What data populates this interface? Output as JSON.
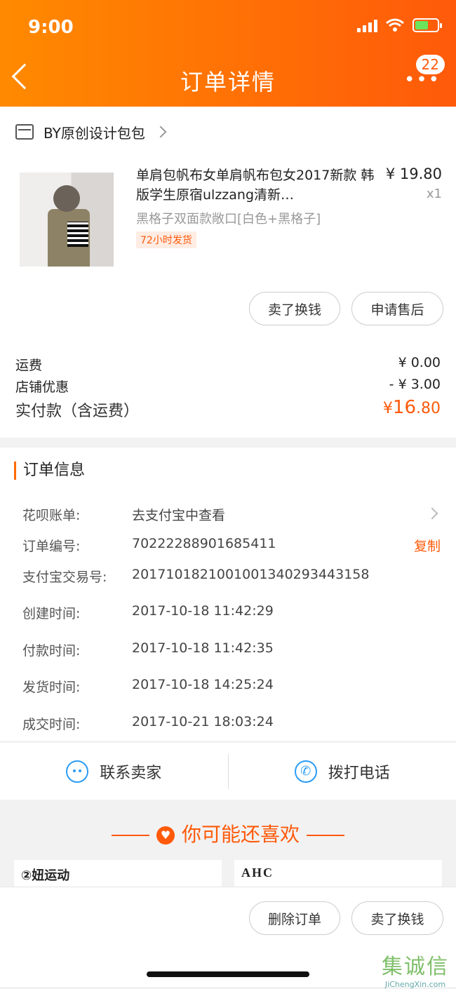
{
  "status": {
    "time": "9:00"
  },
  "header": {
    "title": "订单详情",
    "badge": "22",
    "more": "•••"
  },
  "store": {
    "name": "BY原创设计包包"
  },
  "product": {
    "title": "单肩包帆布女单肩帆布包女2017新款 韩版学生原宿ulzzang清新…",
    "price": "¥ 19.80",
    "qty": "x1",
    "sku": "黑格子双面款敞口[白色+黑格子]",
    "tag": "72小时发货"
  },
  "actions": {
    "sell": "卖了换钱",
    "after_sale": "申请售后"
  },
  "fees": {
    "shipping_label": "运费",
    "shipping_value": "¥ 0.00",
    "discount_label": "店铺优惠",
    "discount_value": "- ¥ 3.00",
    "paid_label": "实付款（含运费）",
    "paid_currency": "¥",
    "paid_int": "16",
    "paid_dec": ".80"
  },
  "order_info": {
    "title": "订单信息",
    "huabei_label": "花呗账单:",
    "huabei_value": "去支付宝中查看",
    "order_no_label": "订单编号:",
    "order_no": "70222288901685411",
    "copy": "复制",
    "alipay_label": "支付宝交易号:",
    "alipay_no": "2017101821001001340293443158",
    "created_label": "创建时间:",
    "created": "2017-10-18 11:42:29",
    "paid_label": "付款时间:",
    "paid": "2017-10-18 11:42:35",
    "shipped_label": "发货时间:",
    "shipped": "2017-10-18 14:25:24",
    "closed_label": "成交时间:",
    "closed": "2017-10-21 18:03:24"
  },
  "contact": {
    "seller": "联系卖家",
    "call": "拨打电话"
  },
  "recommend": {
    "title": "你可能还喜欢",
    "brand1": "②妞运动",
    "brand2": "AHC"
  },
  "bottom": {
    "delete": "删除订单",
    "sell": "卖了换钱"
  },
  "watermark": {
    "title": "集诚信",
    "site": "JiChengXin.com"
  }
}
